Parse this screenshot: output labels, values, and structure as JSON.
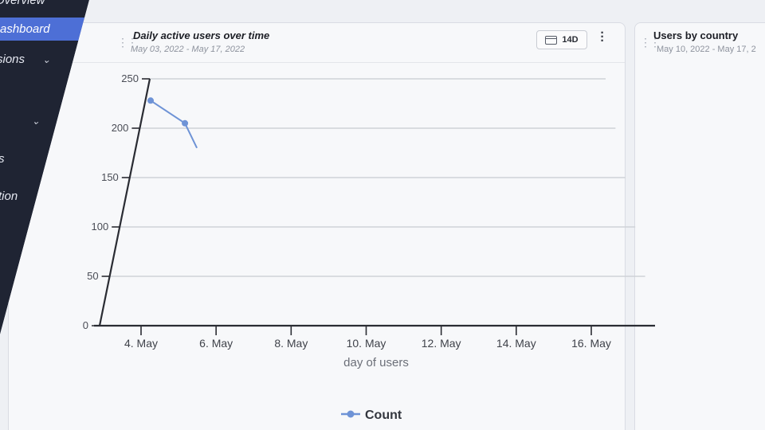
{
  "sidebar": {
    "items": [
      {
        "label": "Overview",
        "chevron": false
      },
      {
        "label": "ashboard",
        "chevron": false,
        "active": true
      },
      {
        "label": "sions",
        "chevron": true
      },
      {
        "label": "",
        "chevron": true
      },
      {
        "label": "s",
        "chevron": false
      },
      {
        "label": "tion",
        "chevron": false
      }
    ]
  },
  "card1": {
    "title": "Daily active users over time",
    "subtitle": "May 03, 2022 - May 17, 2022",
    "range_label": "14D"
  },
  "card2": {
    "title": "Users by country",
    "subtitle": "May 10, 2022 - May 17, 2"
  },
  "colors": {
    "sidebar_bg": "#1f2433",
    "sidebar_active": "#4d6fd6",
    "series_color": "#6e93d6"
  },
  "chart_data": {
    "type": "line",
    "title": "",
    "xlabel": "day of users",
    "ylabel": "",
    "ylim": [
      0,
      250
    ],
    "yticks": [
      0,
      50,
      100,
      150,
      200,
      250
    ],
    "xticks": [
      "4. May",
      "6. May",
      "8. May",
      "10. May",
      "12. May",
      "14. May",
      "16. May"
    ],
    "grid": true,
    "legend_placement": "bottom-center",
    "series": [
      {
        "name": "Count",
        "x": [
          "2022-05-04",
          "2022-05-05"
        ],
        "values": [
          228,
          205
        ],
        "trailing_value": 180
      }
    ]
  }
}
